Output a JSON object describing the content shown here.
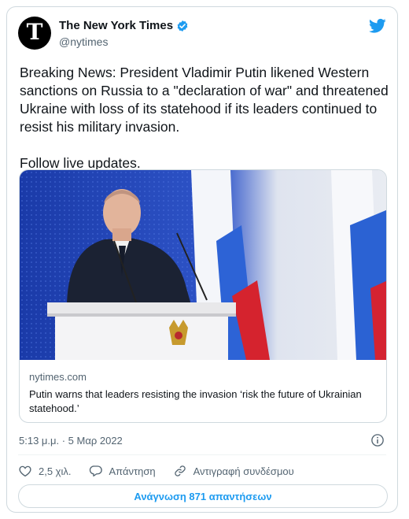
{
  "author": {
    "name": "The New York Times",
    "handle": "@nytimes",
    "avatar_glyph": "T"
  },
  "tweet": {
    "text": "Breaking News: President Vladimir Putin likened Western sanctions on Russia to a \"declaration of war\" and threatened Ukraine with loss of its statehood if its leaders continued to resist his military invasion.",
    "follow_text": "Follow live updates."
  },
  "link_card": {
    "domain": "nytimes.com",
    "title": "Putin warns that leaders resisting the invasion ‘risk the future of Ukrainian statehood.’"
  },
  "meta": {
    "timestamp": "5:13 μ.μ. · 5 Μαρ 2022"
  },
  "actions": {
    "likes": "2,5 χιλ.",
    "reply": "Απάντηση",
    "copy_link": "Αντιγραφή συνδέσμου"
  },
  "replies_button": "Ανάγνωση 871 απαντήσεων",
  "colors": {
    "accent": "#1d9bf0",
    "text_secondary": "#536471",
    "border": "#cfd9de"
  },
  "icons": [
    "verified-badge-icon",
    "twitter-bird-icon",
    "info-icon",
    "heart-icon",
    "reply-icon",
    "link-icon"
  ]
}
